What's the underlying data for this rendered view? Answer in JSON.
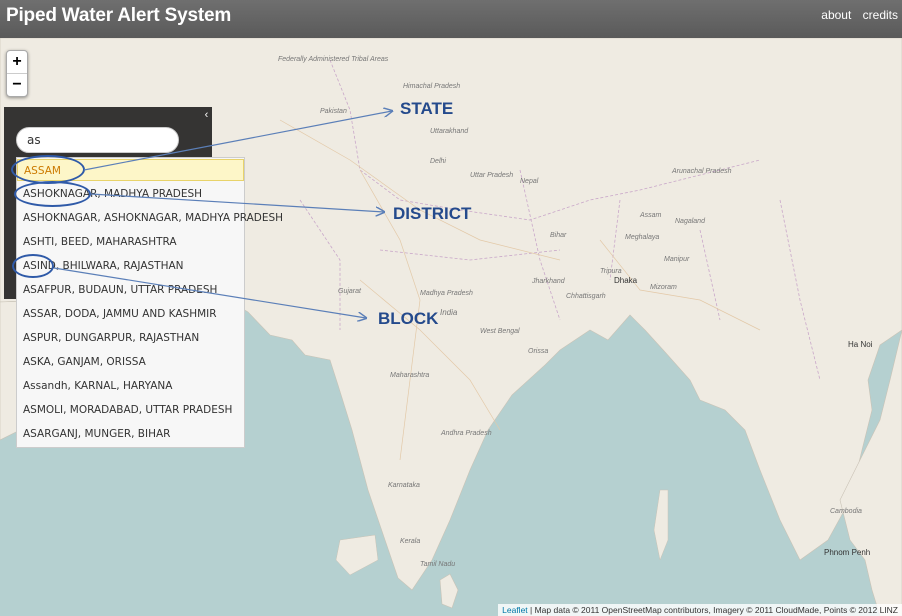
{
  "header": {
    "title": "Piped Water Alert System",
    "nav": [
      "about",
      "credits"
    ]
  },
  "map": {
    "zoom_in": "+",
    "zoom_out": "−",
    "labels": [
      "Pakistan",
      "Nepal",
      "Dhaka",
      "Maharashtra",
      "Madhya Pradesh",
      "West Bengal",
      "Orissa",
      "Chhattisgarh",
      "Bihar",
      "Uttar Pradesh",
      "Gujarat",
      "Karnataka",
      "Andhra Pradesh",
      "Tamil Nadu",
      "Assam",
      "Meghalaya",
      "Jharkhand",
      "Uttarakhand",
      "Himachal Pradesh",
      "Arunachal Pradesh",
      "Nagaland",
      "Manipur",
      "Mizoram",
      "Tripura",
      "Ha Noi",
      "Cambodia",
      "Phnom Penh",
      "Kerala",
      "Delhi",
      "India",
      "Federally Administered Tribal Areas"
    ]
  },
  "sidebar": {
    "collapse_icon": "‹"
  },
  "search": {
    "value": "as",
    "suggestions": [
      "ASSAM",
      "ASHOKNAGAR, MADHYA PRADESH",
      "ASHOKNAGAR, ASHOKNAGAR, MADHYA PRADESH",
      "ASHTI, BEED, MAHARASHTRA",
      "ASIND, BHILWARA, RAJASTHAN",
      "ASAFPUR, BUDAUN, UTTAR PRADESH",
      "ASSAR, DODA, JAMMU AND KASHMIR",
      "ASPUR, DUNGARPUR, RAJASTHAN",
      "ASKA, GANJAM, ORISSA",
      "Assandh, KARNAL, HARYANA",
      "ASMOLI, MORADABAD, UTTAR PRADESH",
      "ASARGANJ, MUNGER, BIHAR"
    ]
  },
  "annotations": {
    "state": "STATE",
    "district": "DISTRICT",
    "block": "BLOCK"
  },
  "attribution": {
    "leaflet": "Leaflet",
    "text": " | Map data © 2011 OpenStreetMap contributors, Imagery © 2011 CloudMade, Points © 2012 LINZ"
  }
}
